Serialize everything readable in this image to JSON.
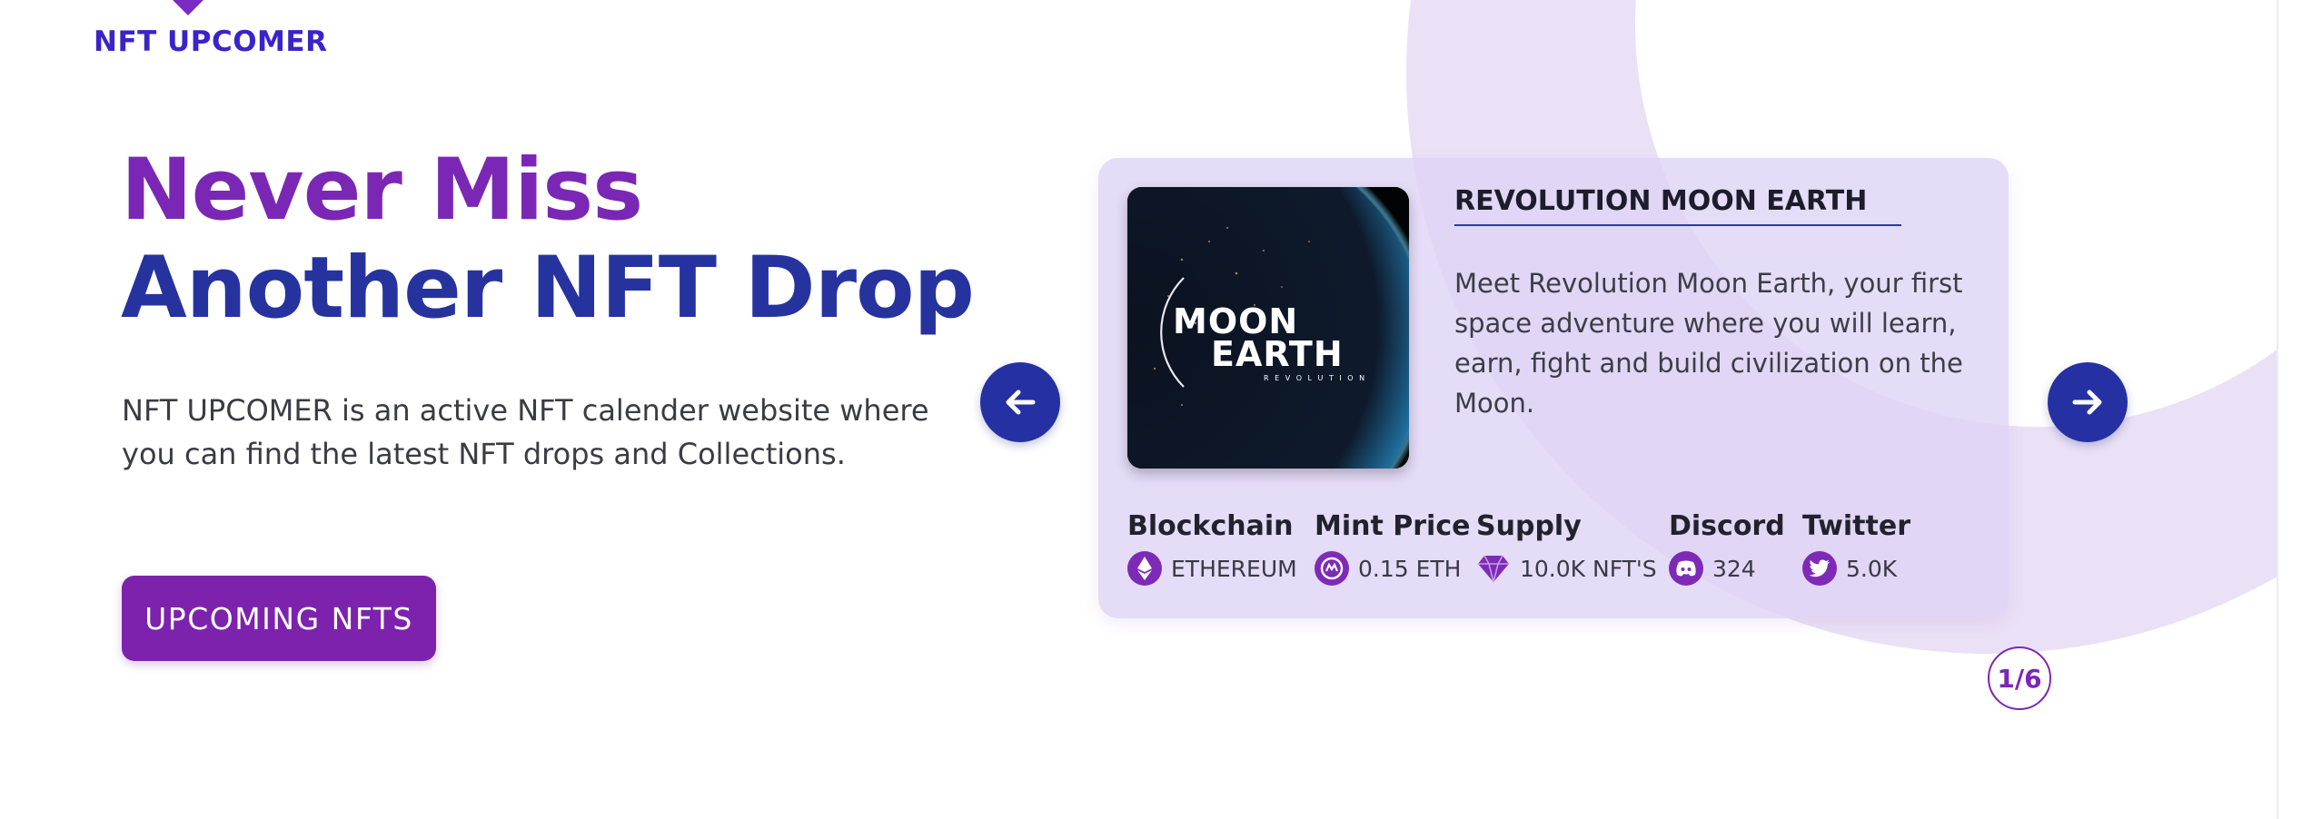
{
  "logo": {
    "text": "NFT UPCOMER"
  },
  "hero": {
    "title_line1": "Never Miss",
    "title_line2": "Another NFT Drop",
    "description": "NFT UPCOMER is an active NFT calender website where you can find the latest NFT drops and Collections.",
    "cta_label": "UPCOMING NFTS"
  },
  "card": {
    "title": "REVOLUTION MOON EARTH",
    "description": "Meet Revolution Moon Earth, your first space adventure where you will learn, earn, fight and build civilization on the Moon.",
    "image": {
      "line1": "MOON",
      "line2": "EARTH",
      "line3": "R E V O L U T I O N"
    },
    "stats": [
      {
        "label": "Blockchain",
        "value": "ETHEREUM",
        "icon": "ethereum-icon"
      },
      {
        "label": "Mint Price",
        "value": "0.15 ETH",
        "icon": "coin-icon"
      },
      {
        "label": "Supply",
        "value": "10.0K NFT'S",
        "icon": "diamond-icon"
      },
      {
        "label": "Discord",
        "value": "324",
        "icon": "discord-icon"
      },
      {
        "label": "Twitter",
        "value": "5.0K",
        "icon": "twitter-icon"
      }
    ]
  },
  "carousel": {
    "counter": "1/6"
  },
  "colors": {
    "brand_purple": "#7b27b5",
    "brand_blue": "#26339f",
    "logo_blue": "#3a24c9",
    "card_bg": "#ded2f6"
  }
}
